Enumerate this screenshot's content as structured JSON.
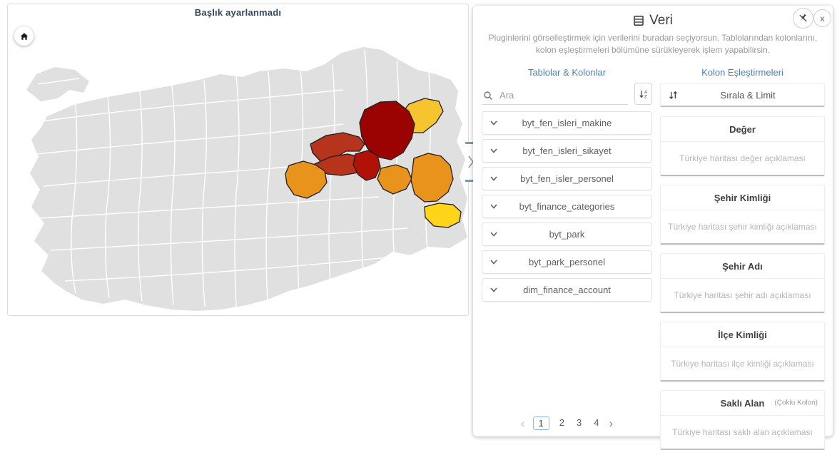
{
  "colors": {
    "accent_blue": "#4a7fbe",
    "map_base": "#e0e0e0",
    "map_border": "#ffffff",
    "province_outline": "#1f1f1f",
    "dark_red": "#9b0202",
    "brick_red": "#b5341b",
    "mid_red": "#b01208",
    "orange": "#e8931c",
    "gold": "#f6c42e",
    "yellow": "#ffd419"
  },
  "map_panel": {
    "title": "Başlık ayarlanmadı",
    "provinces": [
      {
        "name": "province-gold-northeast",
        "color_key": "gold"
      },
      {
        "name": "province-dark-red-large",
        "color_key": "dark_red"
      },
      {
        "name": "province-brick-upper",
        "color_key": "brick_red"
      },
      {
        "name": "province-brick-lower",
        "color_key": "brick_red"
      },
      {
        "name": "province-red-small",
        "color_key": "mid_red"
      },
      {
        "name": "province-orange-west",
        "color_key": "orange"
      },
      {
        "name": "province-orange-middle",
        "color_key": "orange"
      },
      {
        "name": "province-orange-east",
        "color_key": "orange"
      },
      {
        "name": "province-yellow-southeast",
        "color_key": "yellow"
      }
    ]
  },
  "drawer": {
    "expander_direction": "right"
  },
  "data_panel": {
    "title": "Veri",
    "subtitle": "Pluginlerini görselleştirmek için verilerini buradan seçiyorsun. Tablolarından kolonlarını, kolon eşleştirmeleri bölümüne sürükleyerek işlem yapabilirsin.",
    "tables_section": {
      "header": "Tablolar & Kolonlar",
      "search_placeholder": "Ara",
      "tables": [
        "byt_fen_isleri_makine",
        "byt_fen_isleri_sikayet",
        "byt_fen_isler_personel",
        "byt_finance_categories",
        "byt_park",
        "byt_park_personel",
        "dim_finance_account"
      ],
      "pagination": {
        "prev": "‹",
        "next": "›",
        "pages": [
          "1",
          "2",
          "3",
          "4"
        ],
        "current": "1"
      }
    },
    "mappings_section": {
      "header": "Kolon Eşleştirmeleri",
      "sort_limit_label": "Sırala & Limit",
      "groups": [
        {
          "title": "Değer",
          "badge": "",
          "placeholder": "Türkiye haritası değer açıklaması"
        },
        {
          "title": "Şehir Kimliği",
          "badge": "",
          "placeholder": "Türkiye haritası şehir kimliği açıklaması"
        },
        {
          "title": "Şehir Adı",
          "badge": "",
          "placeholder": "Türkiye haritası şehir adı açıklaması"
        },
        {
          "title": "İlçe Kimliği",
          "badge": "",
          "placeholder": "Türkiye haritası ilçe kimliği açıklaması"
        },
        {
          "title": "Saklı Alan",
          "badge": "(Çoklu Kolon)",
          "placeholder": "Türkiye haritası saklı alan açıklaması"
        }
      ]
    }
  }
}
